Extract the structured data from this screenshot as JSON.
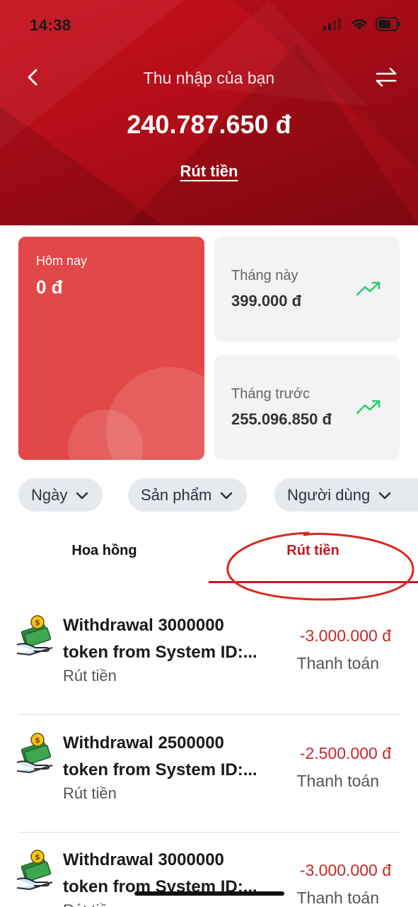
{
  "status_bar": {
    "time": "14:38"
  },
  "header": {
    "title": "Thu nhập của bạn",
    "balance": "240.787.650 đ",
    "withdraw_link": "Rút tiền",
    "bg_color": "#c8101e"
  },
  "stats": {
    "today": {
      "label": "Hôm nay",
      "value": "0 đ"
    },
    "this_month": {
      "label": "Tháng này",
      "value": "399.000 đ"
    },
    "last_month": {
      "label": "Tháng trước",
      "value": "255.096.850 đ"
    }
  },
  "filters": [
    {
      "label": "Ngày"
    },
    {
      "label": "Sản phẩm"
    },
    {
      "label": "Người dùng"
    }
  ],
  "tabs": [
    {
      "label": "Hoa hồng",
      "active": false
    },
    {
      "label": "Rút tiền",
      "active": true
    }
  ],
  "transactions": [
    {
      "title_line1": "Withdrawal 3000000",
      "title_line2": "token from System ID:...",
      "type": "Rút tiền",
      "amount": "-3.000.000 đ",
      "status": "Thanh toán"
    },
    {
      "title_line1": "Withdrawal 2500000",
      "title_line2": "token from System ID:...",
      "type": "Rút tiền",
      "amount": "-2.500.000 đ",
      "status": "Thanh toán"
    },
    {
      "title_line1": "Withdrawal 3000000",
      "title_line2": "token from System ID:...",
      "type": "Rút tiền",
      "amount": "-3.000.000 đ",
      "status": "Thanh toán"
    }
  ],
  "colors": {
    "accent_red": "#c01a22",
    "today_card": "#e34848",
    "trend_green": "#2ecc71",
    "negative_amount": "#c62828"
  }
}
